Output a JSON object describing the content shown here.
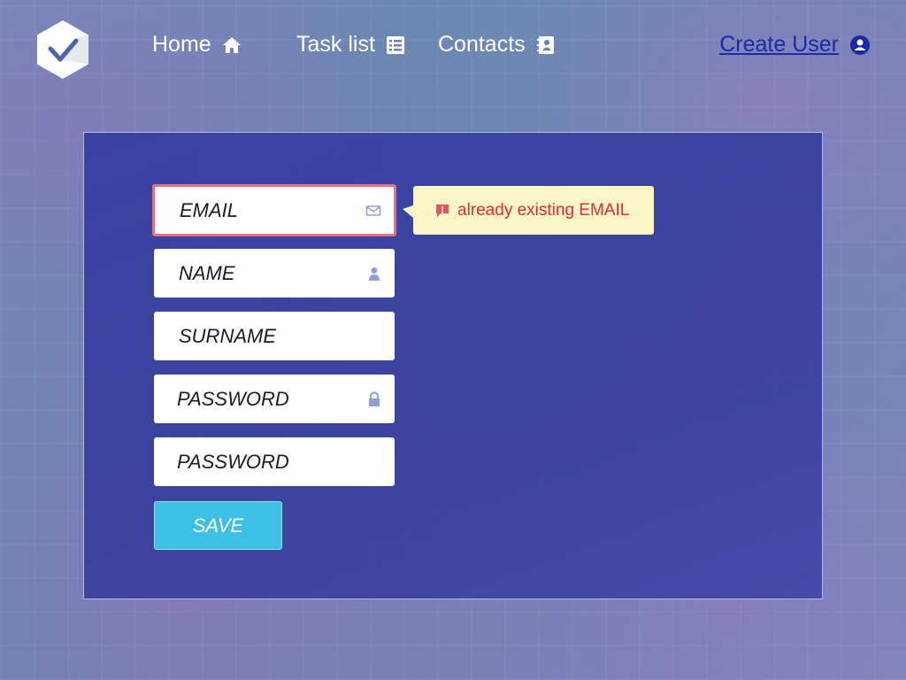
{
  "logo": {
    "icon": "checkmark-hexagon-icon"
  },
  "nav": {
    "home": {
      "label": "Home",
      "icon": "home-icon"
    },
    "tasks": {
      "label": "Task list",
      "icon": "list-icon"
    },
    "contacts": {
      "label": "Contacts",
      "icon": "address-book-icon"
    }
  },
  "create_user": {
    "label": "Create User",
    "icon": "user-circle-icon"
  },
  "form": {
    "email": {
      "placeholder": "EMAIL",
      "icon": "envelope-icon",
      "state": "error"
    },
    "name": {
      "placeholder": "NAME",
      "icon": "person-icon"
    },
    "surname": {
      "placeholder": "SURNAME"
    },
    "password": {
      "placeholder": "PASSWORD",
      "icon": "lock-icon"
    },
    "password_confirm": {
      "placeholder": "PASSWORD"
    },
    "save_label": "SAVE"
  },
  "error_tooltip": {
    "text": "already existing EMAIL",
    "icon": "alert-icon"
  },
  "colors": {
    "accent": "#3cc0e6",
    "error_border": "#e8707a",
    "error_text": "#e02a3a",
    "tooltip_bg": "#fbf6c6",
    "panel": "#343ea0",
    "link": "#1b2aa8"
  }
}
